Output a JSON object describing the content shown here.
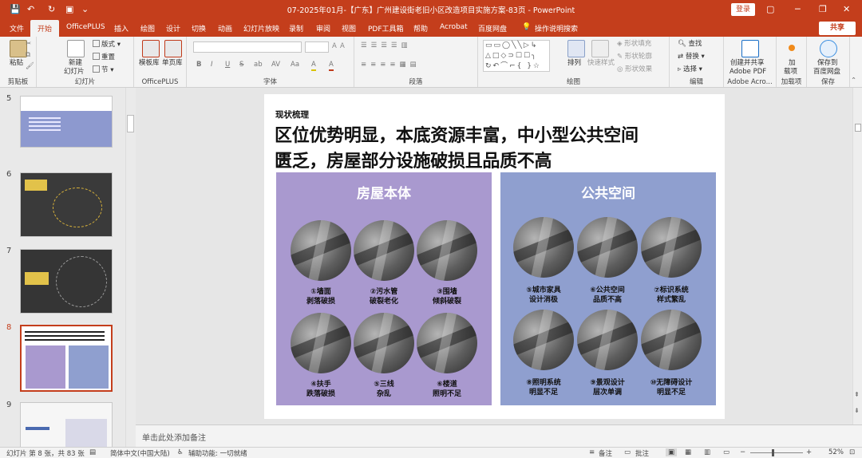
{
  "titlebar": {
    "title": "07-2025年01月-【广东】广州建设街老旧小区改造项目实施方案-83页 - PowerPoint",
    "login": "登录",
    "icons": [
      "save-icon",
      "undo-icon",
      "redo-icon",
      "present-icon",
      "customize-icon",
      "ribbon-display-icon",
      "minimize-icon",
      "restore-icon",
      "close-icon"
    ]
  },
  "menu": {
    "items": [
      "文件",
      "开始",
      "OfficePLUS",
      "插入",
      "绘图",
      "设计",
      "切换",
      "动画",
      "幻灯片放映",
      "录制",
      "审阅",
      "视图",
      "PDF工具箱",
      "帮助",
      "Acrobat",
      "百度网盘",
      "操作说明搜索"
    ],
    "active": "开始",
    "share": "共享"
  },
  "ribbon": {
    "clipboard": {
      "paste": "粘贴",
      "label": "剪贴板"
    },
    "slides": {
      "new_slide_line1": "新建",
      "new_slide_line2": "幻灯片",
      "layout": "版式",
      "reset": "重置",
      "section": "节",
      "label": "幻灯片"
    },
    "officeplus": {
      "template": "模板库",
      "single": "单页库",
      "label": "OfficePLUS"
    },
    "font": {
      "label": "字体",
      "buttons": [
        "B",
        "I",
        "U",
        "S",
        "ab",
        "AV",
        "Aa",
        "A",
        "A"
      ]
    },
    "paragraph": {
      "label": "段落"
    },
    "drawing": {
      "arrange": "排列",
      "quick_styles": "快速样式",
      "fill": "形状填充",
      "outline": "形状轮廓",
      "effects": "形状效果",
      "label": "绘图"
    },
    "editing": {
      "find": "查找",
      "replace": "替换",
      "select": "选择",
      "label": "编辑"
    },
    "adobe": {
      "line1": "创建并共享",
      "line2": "Adobe PDF",
      "label": "Adobe Acro..."
    },
    "addins": {
      "line1": "加",
      "line2": "载项",
      "label": "加载项"
    },
    "save": {
      "line1": "保存到",
      "line2": "百度网盘",
      "label": "保存"
    }
  },
  "thumbnails": [
    {
      "num": "5",
      "variant": "blue"
    },
    {
      "num": "6",
      "variant": "dark"
    },
    {
      "num": "7",
      "variant": "dark"
    },
    {
      "num": "8",
      "variant": "current",
      "selected": true
    },
    {
      "num": "9",
      "variant": "light"
    }
  ],
  "slide": {
    "subtitle": "现状梳理",
    "headline_line1": "区位优势明显，本底资源丰富，中小型公共空间",
    "headline_line2": "匮乏，房屋部分设施破损且品质不高",
    "panels": [
      {
        "title": "房屋本体",
        "color": "#a999cf",
        "items": [
          {
            "line1": "①墙面",
            "line2": "剥落破损"
          },
          {
            "line1": "②污水管",
            "line2": "破裂老化"
          },
          {
            "line1": "③围墙",
            "line2": "倾斜破裂"
          },
          {
            "line1": "④扶手",
            "line2": "跌落破损"
          },
          {
            "line1": "⑤三线",
            "line2": "杂乱"
          },
          {
            "line1": "⑥楼道",
            "line2": "照明不足"
          }
        ]
      },
      {
        "title": "公共空间",
        "color": "#8f9fcf",
        "items": [
          {
            "line1": "⑤城市家具",
            "line2": "设计消极"
          },
          {
            "line1": "⑥公共空间",
            "line2": "品质不高"
          },
          {
            "line1": "⑦标识系统",
            "line2": "样式繁乱"
          },
          {
            "line1": "⑧照明系统",
            "line2": "明显不足"
          },
          {
            "line1": "⑨景观设计",
            "line2": "层次单调"
          },
          {
            "line1": "⑩无障碍设计",
            "line2": "明显不足"
          }
        ]
      }
    ]
  },
  "notes": {
    "placeholder": "单击此处添加备注"
  },
  "status": {
    "slide_info": "幻灯片 第 8 张，共 83 张",
    "language": "简体中文(中国大陆)",
    "accessibility": "辅助功能: 一切就绪",
    "notes": "备注",
    "comments": "批注",
    "zoom": "52%"
  }
}
